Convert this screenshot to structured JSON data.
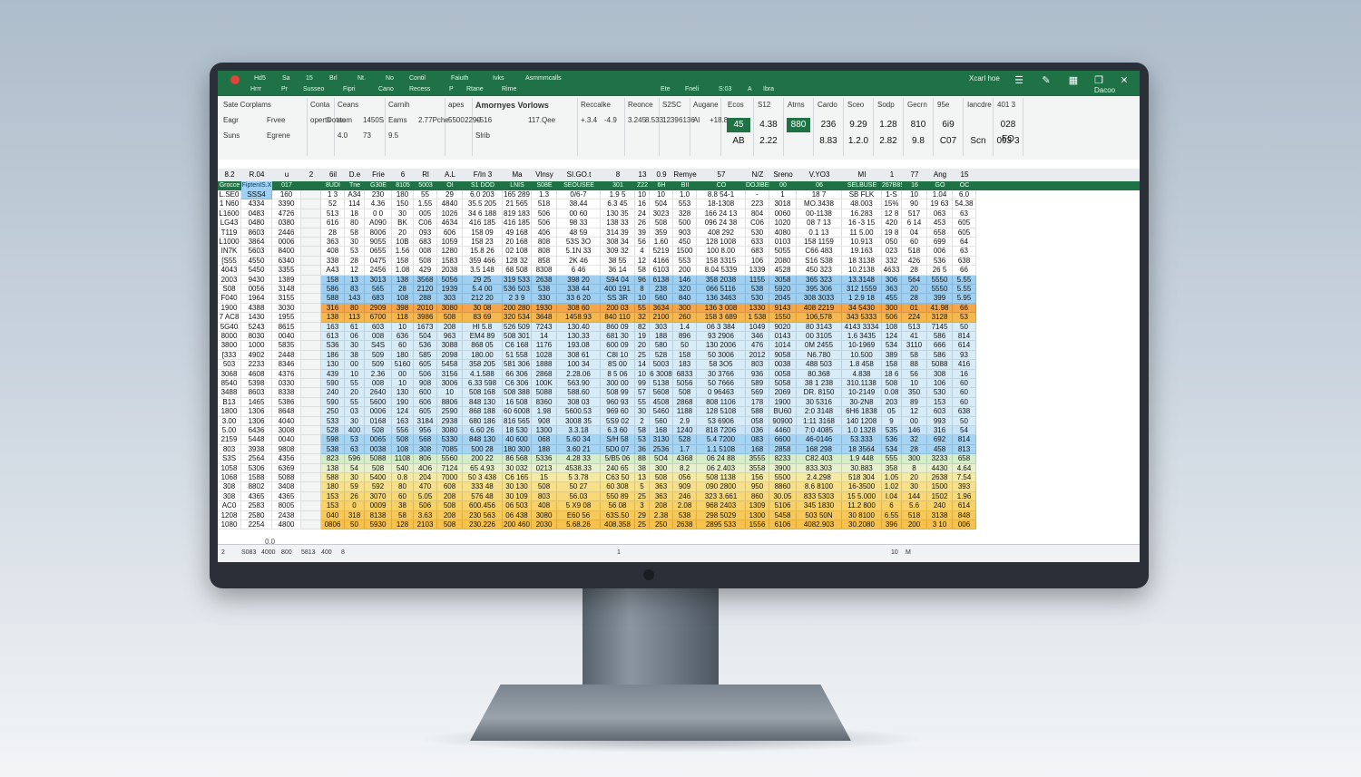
{
  "titlebar": {
    "menu_top": [
      "Hd5",
      "Sa",
      "15",
      "Brl",
      "Nt.",
      "No",
      "Contil",
      "Faiuth",
      "Ivks",
      "Asmmmcalls"
    ],
    "menu_bottom": [
      "Hrrr",
      "Pr",
      "Susseo",
      "Fipri",
      "Cano",
      "Recess",
      "P",
      "Rtane",
      "Rime"
    ],
    "right_label": "Xcarl hoe",
    "sub_right": [
      "Ete",
      "Fneli",
      "S:03",
      "A",
      "Ibra"
    ],
    "window_label": "Dacoo"
  },
  "ribbon": {
    "groups": [
      {
        "title": "Sate Corplams",
        "items": [
          "Eagr",
          "Frvee",
          "Suns",
          "Egrene"
        ]
      },
      {
        "title": "Conta",
        "items": [
          "operts",
          "Dotas"
        ]
      },
      {
        "title": "Ceans",
        "items": [
          "rtom",
          "1450S",
          "4.0",
          "73"
        ]
      },
      {
        "title": "Carnih",
        "items": [
          "Eams",
          "2.77Pche",
          "9.5"
        ]
      },
      {
        "title": "apes",
        "items": [
          "5500",
          "2290"
        ]
      },
      {
        "title": "Amornyes Vorlows",
        "items": [
          "+516",
          "117.Qee",
          "Slrib"
        ]
      },
      {
        "title": "Reccalke",
        "items": [
          "+.3.4",
          "-4.9"
        ]
      },
      {
        "title": "Reonce",
        "items": [
          "3.245",
          "8.533"
        ]
      },
      {
        "title": "S2SC",
        "items": [
          "1239",
          "6136"
        ]
      },
      {
        "title": "Augane",
        "items": [
          "Al",
          "+18.8"
        ]
      }
    ],
    "style_cells": [
      {
        "title": "Ecos",
        "top": "45",
        "bottom": "AB",
        "green": true
      },
      {
        "title": "S12",
        "top": "4.38",
        "bottom": "2.22",
        "green": false
      },
      {
        "title": "Atrns",
        "top": "880",
        "bottom": "",
        "green": true
      },
      {
        "title": "Cardo",
        "top": "236",
        "bottom": "8.83",
        "green": false
      },
      {
        "title": "Sceo",
        "top": "9.29",
        "bottom": "1.2.0",
        "green": false
      },
      {
        "title": "Sodp",
        "top": "1.28",
        "bottom": "2.82",
        "green": false
      },
      {
        "title": "Gecrn",
        "top": "810",
        "bottom": "9.8",
        "green": false
      },
      {
        "title": "95e",
        "top": "6i9",
        "bottom": "C07",
        "green": false
      },
      {
        "title": "Iancdre",
        "top": "",
        "bottom": "Scn",
        "green": false
      },
      {
        "title": "401 3",
        "top": "028 FO",
        "bottom": "093 3",
        "green": false
      }
    ]
  },
  "columns": [
    "8.2",
    "R.04",
    "u",
    "2",
    "6il",
    "D.e",
    "Frie",
    "6",
    "Rl",
    "A.L",
    "F/In 3",
    "Ma",
    "Vlnsy",
    "SI.GO.t",
    "8",
    "13",
    "0.9",
    "Remye",
    "57",
    "N/Z",
    "Sreno",
    "V.YO3",
    "MI",
    "1",
    "77",
    "Ang",
    "15"
  ],
  "green_headers": [
    "Grocce",
    "FiptenIS.X",
    "017",
    "",
    "8UDI",
    "Tne",
    "G30E",
    "8105",
    "5003",
    "OI",
    "S1 DOD",
    "LNIS",
    "S08E",
    "SEOUSEE",
    "301",
    "Z22",
    "6H",
    "BII",
    "CO",
    "DOJIBEL",
    "00",
    "06",
    "SELBUSE",
    "267B8SI",
    "16",
    "GO",
    "OC",
    "O"
  ],
  "rows": [
    [
      "L.SE0",
      "SSS4",
      "160",
      "",
      "1 3",
      "A34",
      "230",
      "180",
      "55",
      "29",
      "6.0 203",
      "165 289",
      "1.3",
      "0/6-7",
      "1.9 5",
      "10",
      "10",
      "1.0",
      "8.8 54-1",
      "-",
      "1",
      "18 7",
      "SB FLK",
      "1-S",
      "10",
      "1.04",
      "6.0"
    ],
    [
      "1 N60",
      "4334",
      "3390",
      "",
      "52",
      "114",
      "4.36",
      "150",
      "1.55",
      "4840",
      "35.5 205",
      "21 565",
      "518",
      "38.44",
      "6.3 45",
      "16",
      "504",
      "553",
      "18-1308",
      "223",
      "3018",
      "MO.3438",
      "48.003",
      "15%",
      "90",
      "19 63",
      "54.38"
    ],
    [
      "L1600",
      "0483",
      "4726",
      "",
      "513",
      "18",
      "0 0",
      "30",
      "005",
      "1026",
      "34 6 188",
      "819 183",
      "506",
      "00 60",
      "130 35",
      "24",
      "3023",
      "328",
      "166 24 13",
      "804",
      "0060",
      "00-1138",
      "16.283",
      "12 8",
      "517",
      "063",
      "63"
    ],
    [
      "LG43",
      "0480",
      "0380",
      "",
      "616",
      "80",
      "A090",
      "BK",
      "C06",
      "4634",
      "416 185",
      "416 185",
      "506",
      "98 33",
      "138 33",
      "26",
      "508",
      "500",
      "096 24 38",
      "C06",
      "1020",
      "08 7 13",
      "16 -3 15",
      "420",
      "6 14",
      "453",
      "605"
    ],
    [
      "T119",
      "8603",
      "2446",
      "",
      "28",
      "58",
      "8006",
      "20",
      "093",
      "606",
      "158 09",
      "49 168",
      "406",
      "48 59",
      "314 39",
      "39",
      "359",
      "903",
      "408 292",
      "530",
      "4080",
      "0.1 13",
      "11 5.00",
      "19 8",
      "04",
      "658",
      "605"
    ],
    [
      "L1000",
      "3864",
      "0006",
      "",
      "363",
      "30",
      "9055",
      "10B",
      "683",
      "1059",
      "158 23",
      "20 168",
      "808",
      "53S 3O",
      "308 34",
      "56",
      "1.60",
      "450",
      "128 1008",
      "633",
      "0103",
      "158 1159",
      "10.913",
      "050",
      "60",
      "699",
      "64"
    ],
    [
      "IN7K",
      "5603",
      "8400",
      "",
      "408",
      "53",
      "0655",
      "1.56",
      "008",
      "1280",
      "15.8 26",
      "02 108",
      "808",
      "5.1N 33",
      "309 32",
      "4",
      "5219",
      "1500",
      "100 8.00",
      "683",
      "5055",
      "C66 483",
      "19.163",
      "023",
      "518",
      "006",
      "63"
    ],
    [
      "[S55",
      "4550",
      "6340",
      "",
      "338",
      "28",
      "0475",
      "158",
      "508",
      "1583",
      "359 466",
      "128 32",
      "858",
      "2K 46",
      "38 55",
      "12",
      "4166",
      "553",
      "158 3315",
      "106",
      "2080",
      "S16 S38",
      "18 3138",
      "332",
      "426",
      "536",
      "638"
    ],
    [
      "4043",
      "5450",
      "3355",
      "",
      "A43",
      "12",
      "2456",
      "1.08",
      "429",
      "2038",
      "3.5 148",
      "68 508",
      "8308",
      "6 46",
      "36 14",
      "58",
      "6103",
      "200",
      "8.04 5339",
      "1339",
      "4528",
      "450 323",
      "10.2138",
      "4633",
      "28",
      "26 5",
      "66"
    ],
    [
      "2003",
      "9430",
      "1389",
      "",
      "158",
      "13",
      "3013",
      "138",
      "3568",
      "5056",
      "29 25",
      "319 533",
      "2638",
      "398 20",
      "S94 04",
      "96",
      "6138",
      "146",
      "358 2038",
      "1155",
      "3058",
      "365 323",
      "13.3148",
      "306",
      "564",
      "5550",
      "5.55"
    ],
    [
      "S08",
      "0056",
      "3148",
      "",
      "586",
      "83",
      "565",
      "28",
      "2120",
      "1939",
      "5.4 00",
      "536 503",
      "538",
      "338 44",
      "400 191",
      "8",
      "238",
      "320",
      "066 5116",
      "538",
      "5920",
      "395 306",
      "312 1559",
      "363",
      "20",
      "5550",
      "5.55"
    ],
    [
      "F040",
      "1964",
      "3155",
      "",
      "588",
      "143",
      "683",
      "108",
      "288",
      "303",
      "212 20",
      "2 3 9",
      "330",
      "33 6 20",
      "SS 3R",
      "10",
      "560",
      "840",
      "136 3463",
      "530",
      "2045",
      "308 3033",
      "1 2.9 18",
      "455",
      "28",
      "399",
      "5.95"
    ],
    [
      "1900",
      "4388",
      "3030",
      "",
      "316",
      "80",
      "2909",
      "398",
      "2010",
      "3080",
      "30 08",
      "200 280",
      "1930",
      "308 60",
      "200 03",
      "55",
      "3634",
      "300",
      "136 3 008",
      "1330",
      "9143",
      "408 2219",
      "34 5430",
      "300",
      "01",
      "41.98",
      "66"
    ],
    [
      "7 AC8",
      "1430",
      "1955",
      "",
      "138",
      "113",
      "6700",
      "118",
      "3986",
      "508",
      "83 69",
      "320 534",
      "3648",
      "1458.93",
      "840 110",
      "32",
      "2100",
      "260",
      "158 3 689",
      "1 538",
      "1550",
      "106,578",
      "343 5333",
      "506",
      "224",
      "3128",
      "53"
    ],
    [
      "5G40",
      "5243",
      "8615",
      "",
      "163",
      "61",
      "603",
      "10",
      "1673",
      "208",
      "HI 5.8",
      "526 509",
      "7243",
      "130.40",
      "860 09",
      "82",
      "303",
      "1.4",
      "06 3 384",
      "1049",
      "9020",
      "80 3143",
      "4143 3334",
      "108",
      "513",
      "7145",
      "50"
    ],
    [
      "8000",
      "8030",
      "0040",
      "",
      "613",
      "06",
      "008",
      "636",
      "504",
      "963",
      "EM4 89",
      "508 301",
      "14",
      "130.33",
      "681 30",
      "19",
      "188",
      "896",
      "93 2906",
      "346",
      "0143",
      "00 3105",
      "1.6 3435",
      "124",
      "41",
      "586",
      "814"
    ],
    [
      "3800",
      "1000",
      "5835",
      "",
      "S36",
      "30",
      "S4S",
      "60",
      "536",
      "3088",
      "868 05",
      "C6 168",
      "1176",
      "193.08",
      "600 09",
      "20",
      "580",
      "50",
      "130 2006",
      "476",
      "1014",
      "0M 2455",
      "10-1969",
      "534",
      "3110",
      "666",
      "614"
    ],
    [
      "[333",
      "4902",
      "2448",
      "",
      "186",
      "38",
      "509",
      "180",
      "585",
      "2098",
      "180.00",
      "51 558",
      "1028",
      "308 61",
      "C8I 10",
      "25",
      "528",
      "158",
      "50 3006",
      "2012",
      "9058",
      "N6.780",
      "10.500",
      "389",
      "58",
      "586",
      "93"
    ],
    [
      "503",
      "2233",
      "8346",
      "",
      "130",
      "00",
      "509",
      "5160",
      "605",
      "5458",
      "358 205",
      "581 306",
      "1888",
      "100 34",
      "8S 00",
      "14",
      "5003",
      "183",
      "58 3O5",
      "803",
      "0038",
      "488 503",
      "1.8 458",
      "158",
      "88",
      "5088",
      "416"
    ],
    [
      "3068",
      "4608",
      "4376",
      "",
      "439",
      "10",
      "2.36",
      "00",
      "506",
      "3156",
      "4.1.588",
      "66 306",
      "2868",
      "2.28.06",
      "8 5 06",
      "10",
      "6 3008",
      "6833",
      "30 3766",
      "936",
      "0058",
      "80.368",
      "4.838",
      "18 6",
      "56",
      "308",
      "16"
    ],
    [
      "8540",
      "5398",
      "0330",
      "",
      "590",
      "55",
      "008",
      "10",
      "908",
      "3006",
      "6.33 598",
      "C6 306",
      "100K",
      "563.90",
      "300 00",
      "99",
      "5138",
      "5056",
      "50 7666",
      "589",
      "5058",
      "38 1 238",
      "310.1138",
      "508",
      "10",
      "106",
      "60"
    ],
    [
      "3488",
      "8603",
      "8338",
      "",
      "240",
      "20",
      "2640",
      "130",
      "600",
      "10",
      "508 168",
      "508 388",
      "5088",
      "588.60",
      "508 99",
      "57",
      "5608",
      "508",
      "0 96463",
      "569",
      "2069",
      "DR. 8150",
      "10-2149",
      "0.08",
      "350",
      "530",
      "60"
    ],
    [
      "B13",
      "1465",
      "5386",
      "",
      "590",
      "55",
      "5600",
      "190",
      "606",
      "8806",
      "848 130",
      "16 508",
      "8360",
      "308 03",
      "960 93",
      "55",
      "4508",
      "2868",
      "808 1106",
      "178",
      "1900",
      "30 5316",
      "30-2N8",
      "203",
      "89",
      "153",
      "60"
    ],
    [
      "1800",
      "1306",
      "8648",
      "",
      "250",
      "03",
      "0006",
      "124",
      "605",
      "2590",
      "868 188",
      "60 6008",
      "1.98",
      "5600.53",
      "969 60",
      "30",
      "5460",
      "1188",
      "128 5108",
      "588",
      "BU60",
      "2:0 3148",
      "6H6 1838",
      "05",
      "12",
      "603",
      "638"
    ],
    [
      "3.00",
      "1306",
      "4040",
      "",
      "533",
      "30",
      "0168",
      "163",
      "3184",
      "2938",
      "680 186",
      "816 565",
      "908",
      "3008 35",
      "5S9 02",
      "2",
      "560",
      "2.9",
      "53 6906",
      "058",
      "90900",
      "1:11 3168",
      "140 1208",
      "9",
      "00",
      "993",
      "50"
    ],
    [
      "5.00",
      "6436",
      "3008",
      "",
      "528",
      "400",
      "508",
      "556",
      "956",
      "3080",
      "6.60 26",
      "18 530",
      "1300",
      "3.3.18",
      "6.3 60",
      "58",
      "168",
      "1240",
      "818 7206",
      "036",
      "4460",
      "7:0 4085",
      "1.0 1328",
      "535",
      "146",
      "316",
      "54"
    ],
    [
      "2159",
      "5448",
      "0040",
      "",
      "598",
      "53",
      "0065",
      "508",
      "568",
      "5330",
      "848 130",
      "40 600",
      "068",
      "5.60 34",
      "S/H 58",
      "53",
      "3130",
      "528",
      "5.4 7200",
      "083",
      "6600",
      "46-0146",
      "53.333",
      "536",
      "32",
      "692",
      "814"
    ],
    [
      "803",
      "3938",
      "9808",
      "",
      "538",
      "63",
      "0038",
      "108",
      "308",
      "7085",
      "500 28",
      "180 300",
      "188",
      "3.60 21",
      "5D0 07",
      "36",
      "2536",
      "1.7",
      "1.1 5108",
      "168",
      "2858",
      "168 298",
      "18 3564",
      "534",
      "28",
      "458",
      "813"
    ],
    [
      "S3S",
      "2564",
      "4356",
      "",
      "823",
      "596",
      "5088",
      "1108",
      "806",
      "5560",
      "200 22",
      "86 568",
      "5336",
      "4.28 33",
      "5/B5 06",
      "88",
      "5O4",
      "4368",
      "06 24 88",
      "3555",
      "8233",
      "C82.403",
      "1.9 448",
      "555",
      "300",
      "3233",
      "658"
    ],
    [
      "1058",
      "5306",
      "6369",
      "",
      "138",
      "54",
      "508",
      "540",
      "4O6",
      "7124",
      "65 4.93",
      "30 032",
      "0213",
      "4538.33",
      "240 65",
      "38",
      "300",
      "8.2",
      "06 2.403",
      "3558",
      "3900",
      "833.303",
      "30.883",
      "358",
      "8",
      "4430",
      "4.64"
    ],
    [
      "1068",
      "1588",
      "5088",
      "",
      "588",
      "30",
      "5400",
      "0.8",
      "204",
      "7000",
      "50 3 438",
      "C6 165",
      "15",
      "5 3.78",
      "C63 50",
      "13",
      "508",
      "056",
      "508 1138",
      "156",
      "5500",
      "2.4.298",
      "518 304",
      "1.05",
      "20",
      "2638",
      "7.54"
    ],
    [
      "308",
      "8802",
      "3408",
      "",
      "180",
      "59",
      "592",
      "80",
      "470",
      "608",
      "333 48",
      "30 130",
      "508",
      "50 27",
      "60 308",
      "5",
      "363",
      "909",
      "090 2800",
      "950",
      "8860",
      "8.6 8100",
      "16-3500",
      "1.02",
      "30",
      "1500",
      "393"
    ],
    [
      "308",
      "4365",
      "4365",
      "",
      "153",
      "26",
      "3070",
      "60",
      "5.05",
      "208",
      "576 48",
      "30 109",
      "803",
      "56.03",
      "550 89",
      "25",
      "363",
      "246",
      "323 3.661",
      "860",
      "30.05",
      "833 5303",
      "15 5.000",
      "I.04",
      "144",
      "1502",
      "1.96"
    ],
    [
      "AC0",
      "2583",
      "8005",
      "",
      "153",
      "0",
      "0009",
      "38",
      "506",
      "508",
      "600.456",
      "06 503",
      "408",
      "5 X9 08",
      "56 08",
      "3",
      "208",
      "2.08",
      "968 2403",
      "1309",
      "5106",
      "345 1830",
      "11.2 800",
      "6",
      "5.6",
      "240",
      "614"
    ],
    [
      "1208",
      "2580",
      "2438",
      "",
      "040",
      "318",
      "8138",
      "58",
      "3.63",
      "208",
      "230 563",
      "06 438",
      "3080",
      "E60 56",
      "63S.50",
      "29",
      "2.38",
      "538",
      "298 5029",
      "1300",
      "5458",
      "503 50N",
      "30 8100",
      "6.55",
      "518",
      "3138",
      "848"
    ],
    [
      "1080",
      "2254",
      "4800",
      "",
      "0806",
      "50",
      "5930",
      "128",
      "2103",
      "508",
      "230.226",
      "200 460",
      "2030",
      "5.68.26",
      "408.358",
      "25",
      "250",
      "2638",
      "2895 533",
      "1556",
      "6106",
      "4082.903",
      "30.2080",
      "396",
      "200",
      "3 10",
      "006"
    ]
  ],
  "row_colors": [
    "#ffffff",
    "#ffffff",
    "#ffffff",
    "#ffffff",
    "#ffffff",
    "#ffffff",
    "#ffffff",
    "#ffffff",
    "#ffffff",
    "#9fd0f2",
    "#9fd0f2",
    "#9fd0f2",
    "#f3a64a",
    "#f5b84f",
    "#d8ecf8",
    "#d8ecf8",
    "#d8ecf8",
    "#d8ecf8",
    "#d8ecf8",
    "#d8ecf8",
    "#d8ecf8",
    "#d8ecf8",
    "#d8ecf8",
    "#d8ecf8",
    "#d8ecf8",
    "#c8e4f6",
    "#a6d4f3",
    "#a6d4f3",
    "#d6edcb",
    "#e9f0d0",
    "#f5e9a6",
    "#f6e08c",
    "#f8d978",
    "#f8d167",
    "#f7c95a",
    "#f7c24c"
  ],
  "accent_band_colors": {
    "blue": "#64aee6",
    "orange": "#ee7a36",
    "yellow": "#f2c14a",
    "green": "#b9dcae"
  },
  "footer": {
    "top_value": "0.0",
    "cells": [
      "2",
      "S083",
      "4000",
      "800",
      "5813",
      "400",
      "8"
    ],
    "right_cells": [
      "1",
      "10",
      "M"
    ]
  },
  "colors": {
    "excel_green": "#1e7245",
    "ribbon_bg": "#f3f4f4",
    "header_bg": "#e9ecee"
  }
}
